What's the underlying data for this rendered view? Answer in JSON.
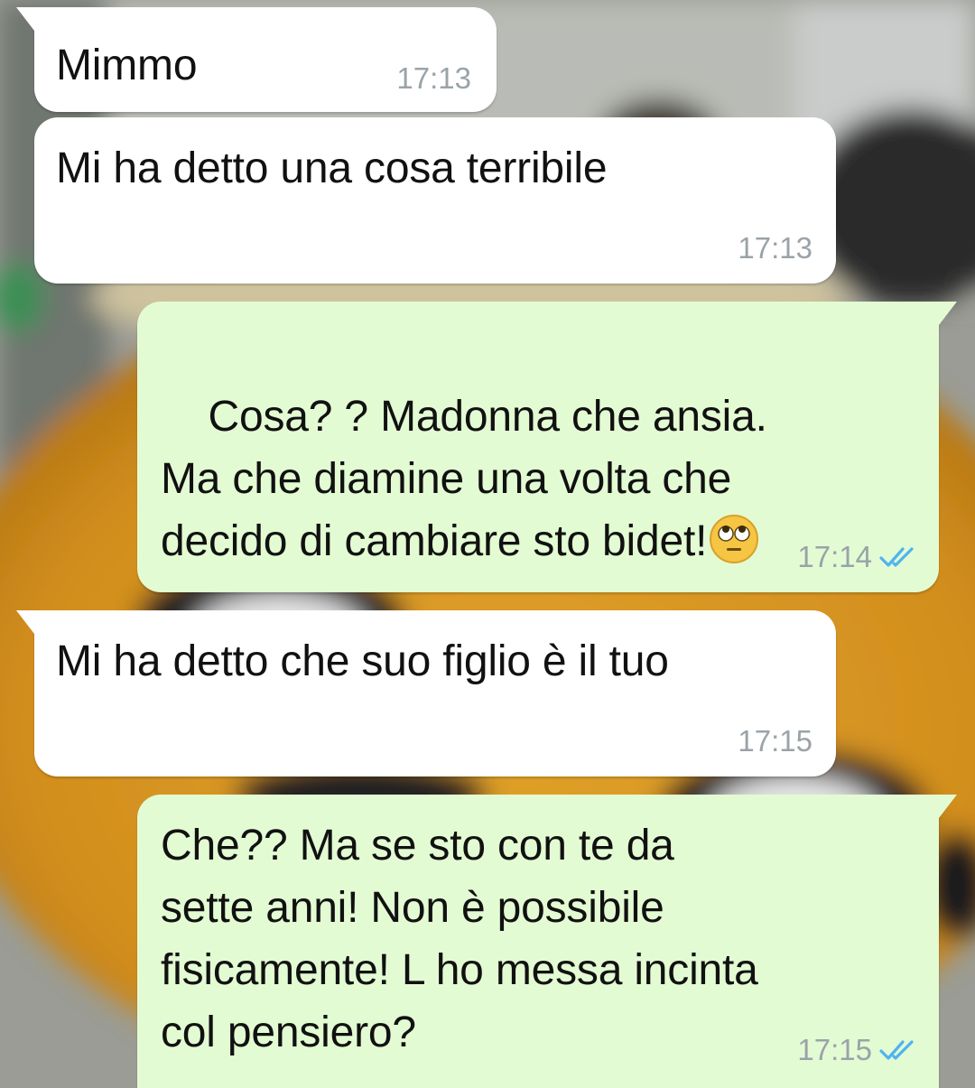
{
  "chat": {
    "messages": [
      {
        "direction": "in",
        "text": "Mimmo",
        "time": "17:13"
      },
      {
        "direction": "in",
        "text": "Mi ha detto una cosa terribile",
        "time": "17:13"
      },
      {
        "direction": "out",
        "text": "Cosa? ? Madonna che ansia.\nMa che diamine una volta che\ndecido di cambiare sto bidet!",
        "emoji": "eye-roll-emoji",
        "time": "17:14",
        "status": "read-double-check-icon"
      },
      {
        "direction": "in",
        "text": "Mi ha detto che suo figlio è il tuo",
        "time": "17:15"
      },
      {
        "direction": "out",
        "text": "Che?? Ma se sto con te da\nsette anni! Non è possibile\nfisicamente! L ho messa incinta\ncol pensiero?",
        "time": "17:15",
        "status": "read-double-check-icon"
      }
    ]
  },
  "colors": {
    "incoming_bubble": "#ffffff",
    "outgoing_bubble": "#e3fbd3",
    "timestamp": "#9aa3a8",
    "read_ticks": "#4fb3f0"
  }
}
